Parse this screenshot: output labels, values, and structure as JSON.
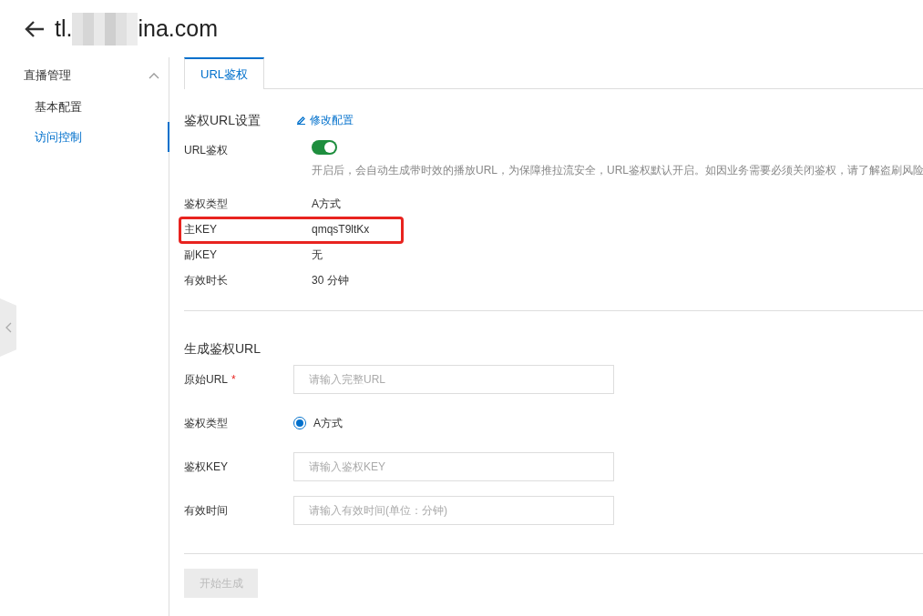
{
  "header": {
    "title_start": "tl.",
    "title_end": "ina.com",
    "redacted": true
  },
  "sidebar": {
    "group": {
      "label": "直播管理",
      "expanded": true,
      "children": [
        {
          "label": "基本配置",
          "selected": false
        },
        {
          "label": "访问控制",
          "selected": true
        }
      ]
    }
  },
  "tabs": [
    {
      "label": "URL鉴权",
      "selected": true
    }
  ],
  "settings": {
    "title": "鉴权URL设置",
    "edit_link": "修改配置",
    "rows": [
      {
        "kind": "toggle",
        "label": "URL鉴权",
        "on": true,
        "note": "开启后，会自动生成带时效的播放URL，为保障推拉流安全，URL鉴权默认开启。如因业务需要必须关闭鉴权，请了解盗刷风险",
        "highlighted": false
      },
      {
        "kind": "text",
        "label": "鉴权类型",
        "value": "A方式",
        "highlighted": false
      },
      {
        "kind": "text",
        "label": "主KEY",
        "value": "qmqsT9ltKx",
        "highlighted": true
      },
      {
        "kind": "text",
        "label": "副KEY",
        "value": "无",
        "highlighted": false
      },
      {
        "kind": "text",
        "label": "有效时长",
        "value": "30 分钟",
        "highlighted": false
      }
    ]
  },
  "generator": {
    "title": "生成鉴权URL",
    "fields": [
      {
        "kind": "input",
        "label": "原始URL",
        "required_mark": "*",
        "placeholder": "请输入完整URL"
      },
      {
        "kind": "radio",
        "label": "鉴权类型",
        "options": [
          {
            "label": "A方式",
            "selected": true
          }
        ]
      },
      {
        "kind": "input",
        "label": "鉴权KEY",
        "placeholder": "请输入鉴权KEY"
      },
      {
        "kind": "input",
        "label": "有效时间",
        "placeholder": "请输入有效时间(单位：分钟)"
      }
    ],
    "button": {
      "label": "开始生成",
      "disabled": true
    }
  }
}
